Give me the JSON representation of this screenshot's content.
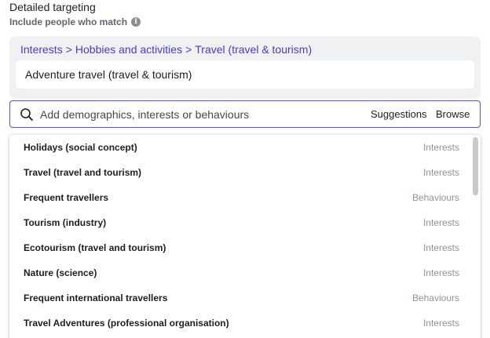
{
  "header": {
    "title": "Detailed targeting",
    "subtitle": "Include people who match",
    "info_icon": "info-icon"
  },
  "breadcrumb": [
    "Interests",
    "Hobbies and activities",
    "Travel (travel & tourism)"
  ],
  "selected": "Adventure travel (travel & tourism)",
  "search": {
    "value": "",
    "placeholder": "Add demographics, interests or behaviours",
    "suggestions_label": "Suggestions",
    "browse_label": "Browse"
  },
  "results": [
    {
      "name": "Holidays (social concept)",
      "category": "Interests"
    },
    {
      "name": "Travel (travel and tourism)",
      "category": "Interests"
    },
    {
      "name": "Frequent travellers",
      "category": "Behaviours"
    },
    {
      "name": "Tourism (industry)",
      "category": "Interests"
    },
    {
      "name": "Ecotourism (travel and tourism)",
      "category": "Interests"
    },
    {
      "name": "Nature (science)",
      "category": "Interests"
    },
    {
      "name": "Frequent international travellers",
      "category": "Behaviours"
    },
    {
      "name": "Travel Adventures (professional organisation)",
      "category": "Interests"
    }
  ],
  "colors": {
    "accent": "#4b3ad6",
    "focus_border": "#5b4ce0",
    "panel_bg": "#f0f1f3",
    "muted_text": "#8d949e"
  }
}
